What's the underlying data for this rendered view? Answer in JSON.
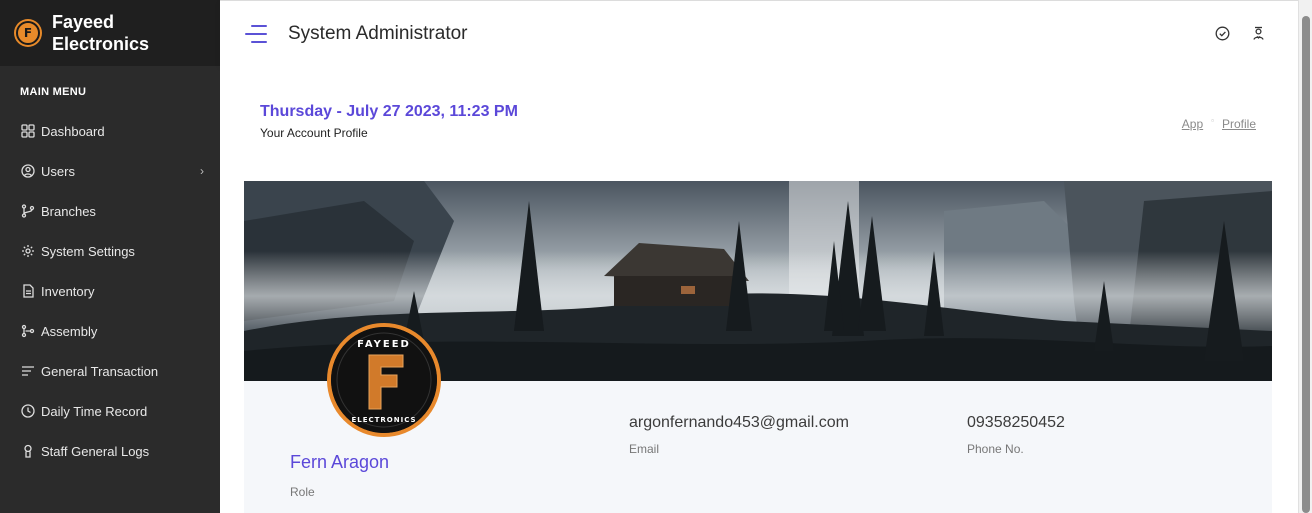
{
  "brand": {
    "name": "Fayeed Electronics",
    "logo_letter": "F"
  },
  "sidebar": {
    "section_title": "MAIN MENU",
    "items": [
      {
        "label": "Dashboard",
        "icon": "grid-icon"
      },
      {
        "label": "Users",
        "icon": "user-circle-icon",
        "has_submenu": true
      },
      {
        "label": "Branches",
        "icon": "branch-icon"
      },
      {
        "label": "System Settings",
        "icon": "gear-icon"
      },
      {
        "label": "Inventory",
        "icon": "document-icon"
      },
      {
        "label": "Assembly",
        "icon": "assembly-icon"
      },
      {
        "label": "General Transaction",
        "icon": "list-lines-icon"
      },
      {
        "label": "Daily Time Record",
        "icon": "clock-icon"
      },
      {
        "label": "Staff General Logs",
        "icon": "person-icon"
      }
    ]
  },
  "header": {
    "title": "System Administrator",
    "actions": [
      "check-circle-icon",
      "user-badge-icon"
    ]
  },
  "page": {
    "date": "Thursday - July 27 2023, 11:23 PM",
    "subtitle": "Your Account Profile",
    "breadcrumb": [
      "App",
      "Profile"
    ]
  },
  "profile": {
    "name": "Fern Aragon",
    "role_label": "Role",
    "email": "argonfernando453@gmail.com",
    "email_label": "Email",
    "phone": "09358250452",
    "phone_label": "Phone No.",
    "avatar_logo": {
      "top_text": "FAYEED",
      "letter": "F",
      "bottom_text": "ELECTRONICS"
    }
  },
  "colors": {
    "accent": "#5b48d9",
    "sidebar_bg": "#2b2b2b",
    "brand_orange": "#e8892c"
  }
}
